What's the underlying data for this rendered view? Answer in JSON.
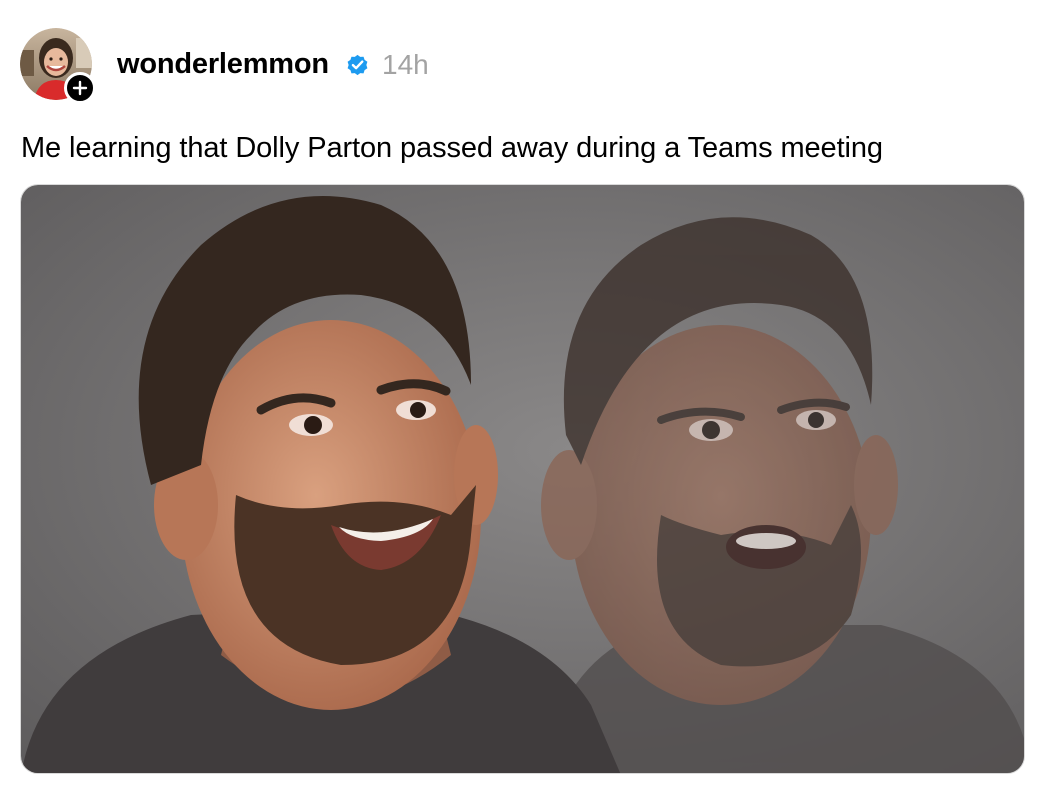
{
  "post": {
    "author": {
      "username": "wonderlemmon",
      "verified_icon": "verified-badge-icon",
      "avatar_icon": "avatar",
      "follow_icon": "plus-icon"
    },
    "timestamp": "14h",
    "caption": "Me learning that Dolly Parton passed away during a Teams meeting",
    "media": {
      "type": "image",
      "description_icon": "meme-photo"
    }
  },
  "colors": {
    "verified": "#1d9bf0",
    "timestamp": "#a3a3a3",
    "text": "#000000",
    "photo_background": "#6b6969"
  }
}
